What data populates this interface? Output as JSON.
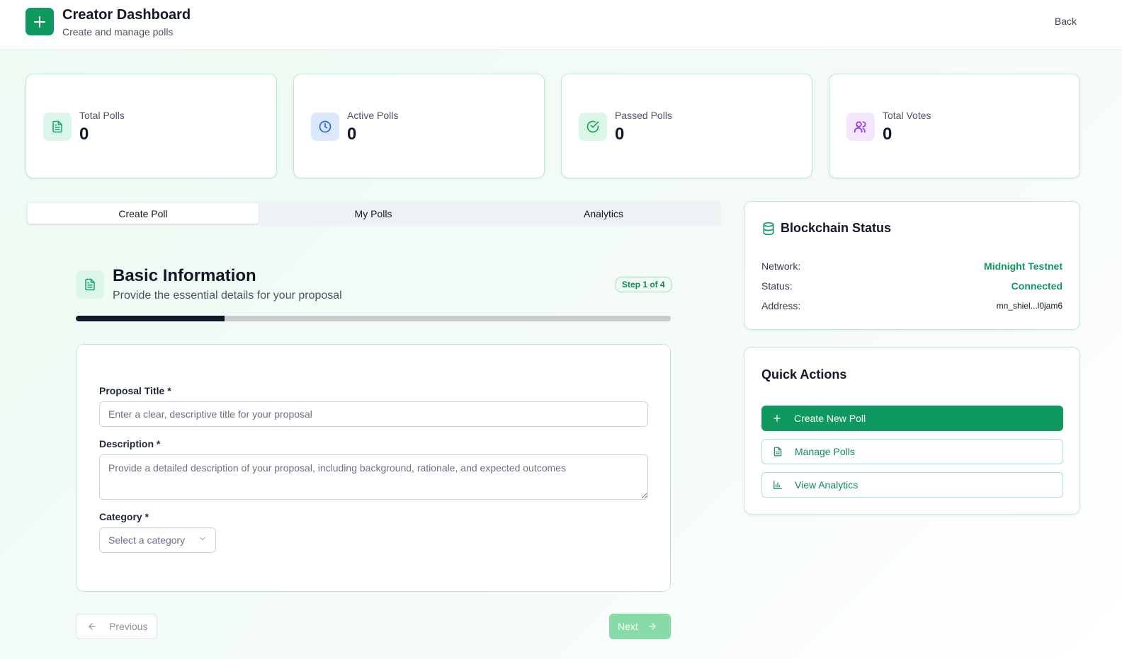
{
  "header": {
    "title": "Creator Dashboard",
    "subtitle": "Create and manage polls",
    "back_label": "Back"
  },
  "stats": [
    {
      "label": "Total Polls",
      "value": "0",
      "icon": "document-icon",
      "icon_bg": "#d9f6e7",
      "icon_color": "#16a06a"
    },
    {
      "label": "Active Polls",
      "value": "0",
      "icon": "clock-icon",
      "icon_bg": "#dbe8fd",
      "icon_color": "#2563eb"
    },
    {
      "label": "Passed Polls",
      "value": "0",
      "icon": "check-circle-icon",
      "icon_bg": "#dcf7e8",
      "icon_color": "#16a34a"
    },
    {
      "label": "Total Votes",
      "value": "0",
      "icon": "users-icon",
      "icon_bg": "#f3e6fd",
      "icon_color": "#9333ea"
    }
  ],
  "tabs": [
    {
      "label": "Create Poll",
      "active": true
    },
    {
      "label": "My Polls",
      "active": false
    },
    {
      "label": "Analytics",
      "active": false
    }
  ],
  "step": {
    "title": "Basic Information",
    "subtitle": "Provide the essential details for your proposal",
    "badge": "Step 1 of 4",
    "progress": 0.25
  },
  "form": {
    "title_label": "Proposal Title *",
    "title_placeholder": "Enter a clear, descriptive title for your proposal",
    "title_value": "",
    "description_label": "Description *",
    "description_placeholder": "Provide a detailed description of your proposal, including background, rationale, and expected outcomes",
    "description_value": "",
    "category_label": "Category *",
    "category_selected": "Select a category"
  },
  "nav": {
    "previous_label": "Previous",
    "next_label": "Next"
  },
  "blockchain": {
    "title": "Blockchain Status",
    "network_label": "Network:",
    "network_value": "Midnight Testnet",
    "status_label": "Status:",
    "status_value": "Connected",
    "address_label": "Address:",
    "address_value": "mn_shiel...l0jam6"
  },
  "quick_actions": {
    "title": "Quick Actions",
    "create_label": "Create New Poll",
    "manage_label": "Manage Polls",
    "analytics_label": "View Analytics"
  },
  "colors": {
    "brand": "#0f9960",
    "accent_light": "#86dba9"
  }
}
